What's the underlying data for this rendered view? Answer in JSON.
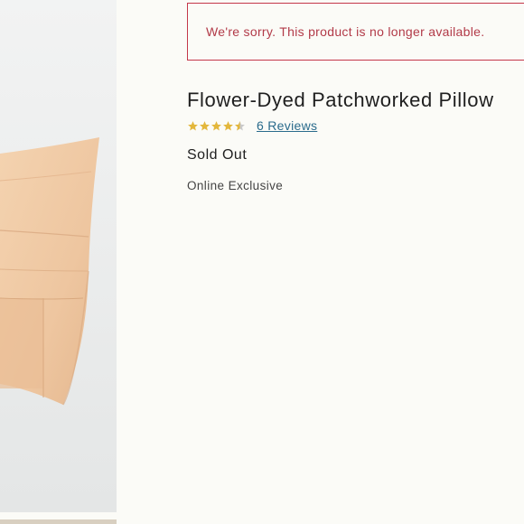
{
  "alert": {
    "message": "We're sorry. This product is no longer available."
  },
  "product": {
    "title": "Flower-Dyed Patchworked Pillow",
    "rating": 4.5,
    "rating_max": 5,
    "reviews_label": "6 Reviews",
    "availability": "Sold Out",
    "badge": "Online Exclusive"
  },
  "colors": {
    "alert_border": "#c4374a",
    "alert_text": "#b23a48",
    "star_filled": "#e3b73c",
    "star_empty": "#c9c9c9",
    "link": "#2a6b8c",
    "pillow": "#eec9a3"
  },
  "icons": {
    "star": "star-icon",
    "half_star": "half-star-icon"
  }
}
